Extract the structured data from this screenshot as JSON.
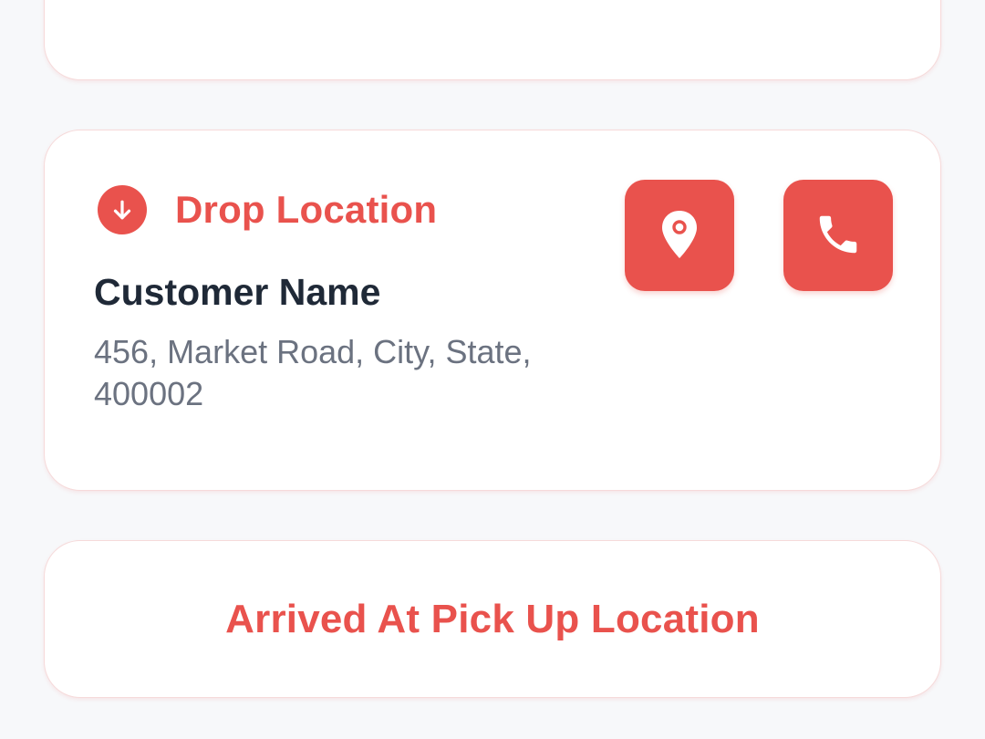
{
  "drop": {
    "title": "Drop Location",
    "customer_name": "Customer Name",
    "address": "456, Market Road, City, State, 400002",
    "icons": {
      "header": "arrow-down-circle-icon",
      "map": "map-pin-icon",
      "call": "phone-icon"
    }
  },
  "action": {
    "label": "Arrived At Pick Up Location"
  },
  "colors": {
    "accent": "#e9524d",
    "name_text": "#1f2937",
    "address_text": "#6b7280",
    "background": "#f7f8fa",
    "card": "#ffffff"
  }
}
